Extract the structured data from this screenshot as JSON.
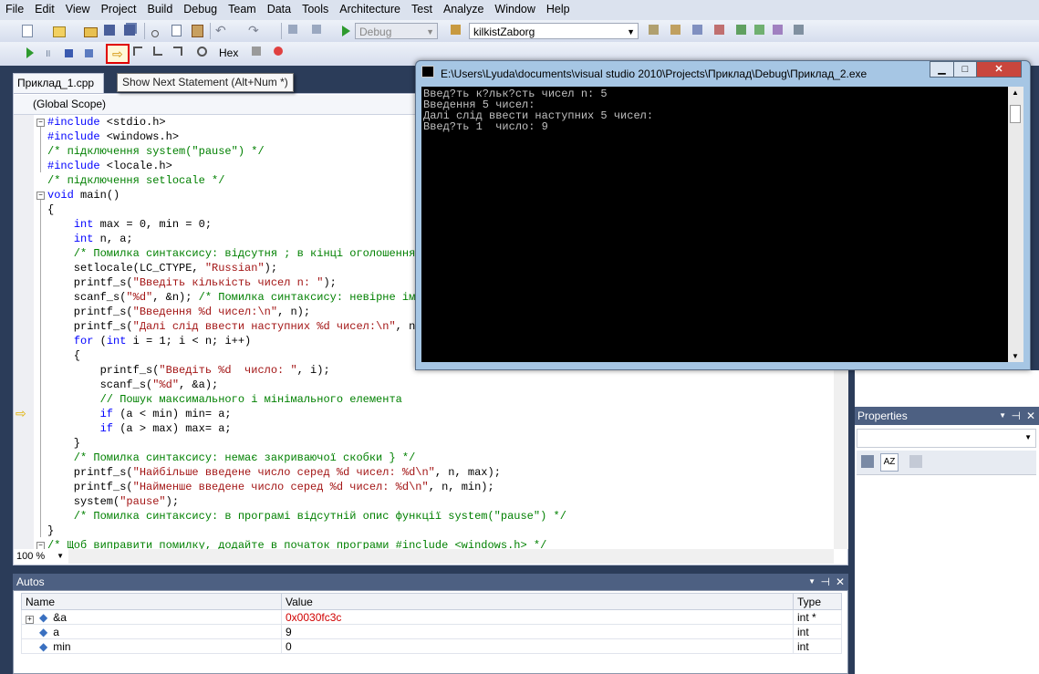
{
  "menu": [
    "File",
    "Edit",
    "View",
    "Project",
    "Build",
    "Debug",
    "Team",
    "Data",
    "Tools",
    "Architecture",
    "Test",
    "Analyze",
    "Window",
    "Help"
  ],
  "toolbar": {
    "config": "Debug",
    "project": "kilkistZaborg",
    "hex_label": "Hex"
  },
  "tooltip": "Show Next Statement (Alt+Num *)",
  "editor": {
    "tab": "Приклад_1.cpp",
    "scope": "(Global Scope)",
    "zoom": "100 %",
    "lines": [
      "#include <stdio.h>",
      "#include <windows.h>",
      "/* підключення system(\"pause\") */",
      "#include <locale.h>",
      "/* підключення setlocale */",
      "void main()",
      "{",
      "    int max = 0, min = 0;",
      "    int n, a;",
      "    /* Помилка синтаксису: відсутня ; в кінці оголошення з",
      "    setlocale(LC_CTYPE, \"Russian\");",
      "    printf_s(\"Введіть кількість чисел n: \");",
      "    scanf_s(\"%d\", &n); /* Помилка синтаксису: невірне ім'я",
      "    printf_s(\"Введення %d чисел:\\n\", n);",
      "    printf_s(\"Далі слід ввести наступних %d чисел:\\n\", n);",
      "    for (int i = 1; i < n; i++)",
      "    {",
      "        printf_s(\"Введіть %d  число: \", i);",
      "        scanf_s(\"%d\", &a);",
      "        // Пошук максимального і мінімального елемента",
      "        if (a < min) min= a;",
      "        if (a > max) max= a;",
      "    }",
      "    /* Помилка синтаксису: немає закриваючої скобки } */",
      "    printf_s(\"Найбільше введене число серед %d чисел: %d\\n\", n, max);",
      "    printf_s(\"Найменше введене число серед %d чисел: %d\\n\", n, min);",
      "    system(\"pause\");",
      "    /* Помилка синтаксису: в програмі відсутній опис функції system(\"pause\") */",
      "}",
      "/* Щоб виправити помилку, додайте в початок програми #include <windows.h> */"
    ]
  },
  "autos": {
    "title": "Autos",
    "columns": [
      "Name",
      "Value",
      "Type"
    ],
    "rows": [
      {
        "name": "&a",
        "value": "0x0030fc3c",
        "type": "int *"
      },
      {
        "name": "a",
        "value": "9",
        "type": "int"
      },
      {
        "name": "min",
        "value": "0",
        "type": "int"
      }
    ]
  },
  "properties": {
    "title": "Properties"
  },
  "console": {
    "title": "E:\\Users\\Lyuda\\documents\\visual studio 2010\\Projects\\Приклад\\Debug\\Приклад_2.exe",
    "lines": [
      "Введ?ть к?льк?сть чисел n: 5",
      "Введення 5 чисел:",
      "Далі слід ввести наступних 5 чисел:",
      "Введ?ть 1  число: 9"
    ]
  }
}
